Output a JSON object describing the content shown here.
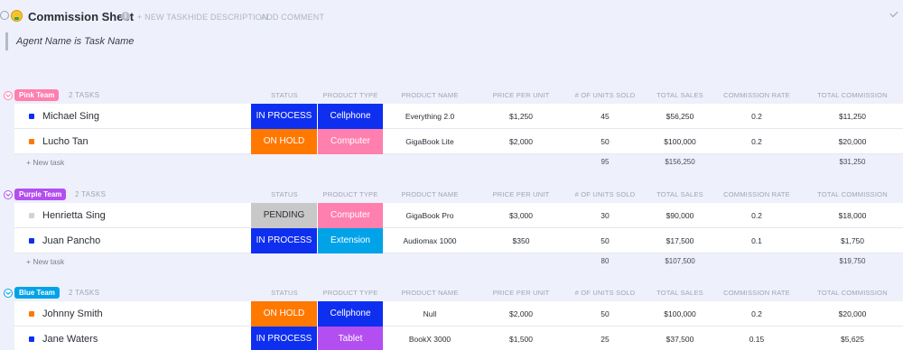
{
  "header": {
    "title": "Commission Sheet",
    "info_icon": "i",
    "actions": [
      "+ NEW TASK",
      "HIDE DESCRIPTION",
      "ADD COMMENT"
    ],
    "description": "Agent Name is Task Name"
  },
  "columns": [
    "STATUS",
    "PRODUCT TYPE",
    "PRODUCT NAME",
    "PRICE PER UNIT",
    "# OF UNITS SOLD",
    "TOTAL SALES",
    "COMMISSION RATE",
    "TOTAL COMMISSION"
  ],
  "colors": {
    "in_process": "#0f2ff0",
    "on_hold": "#ff7800",
    "pending": "#c8c8c8",
    "cellphone": "#0f2ff0",
    "computer": "#ff7fae",
    "extension": "#00a3e8",
    "tablet": "#b34ff0",
    "pink_team": "#ff7fae",
    "purple_team": "#b34ff0",
    "blue_team": "#00a3e8"
  },
  "groups": [
    {
      "name": "Pink Team",
      "color": "#ff7fae",
      "count": "2 TASKS",
      "new_task": "+ New task",
      "totals": {
        "units": "95",
        "sales": "$156,250",
        "commission": "$31,250"
      },
      "rows": [
        {
          "name": "Michael Sing",
          "dot": "#0f2ff0",
          "status": "IN PROCESS",
          "status_color": "#0f2ff0",
          "status_text": "#ffffff",
          "type": "Cellphone",
          "type_color": "#0f2ff0",
          "product": "Everything 2.0",
          "price": "$1,250",
          "units": "45",
          "sales": "$56,250",
          "rate": "0.2",
          "commission": "$11,250"
        },
        {
          "name": "Lucho Tan",
          "dot": "#ff7800",
          "status": "ON HOLD",
          "status_color": "#ff7800",
          "status_text": "#ffffff",
          "type": "Computer",
          "type_color": "#ff7fae",
          "product": "GigaBook Lite",
          "price": "$2,000",
          "units": "50",
          "sales": "$100,000",
          "rate": "0.2",
          "commission": "$20,000"
        }
      ]
    },
    {
      "name": "Purple Team",
      "color": "#b34ff0",
      "count": "2 TASKS",
      "new_task": "+ New task",
      "totals": {
        "units": "80",
        "sales": "$107,500",
        "commission": "$19,750"
      },
      "rows": [
        {
          "name": "Henrietta Sing",
          "dot": "#d3d3d3",
          "status": "PENDING",
          "status_color": "#c8c8c8",
          "status_text": "#2a2e34",
          "type": "Computer",
          "type_color": "#ff7fae",
          "product": "GigaBook Pro",
          "price": "$3,000",
          "units": "30",
          "sales": "$90,000",
          "rate": "0.2",
          "commission": "$18,000"
        },
        {
          "name": "Juan Pancho",
          "dot": "#0f2ff0",
          "status": "IN PROCESS",
          "status_color": "#0f2ff0",
          "status_text": "#ffffff",
          "type": "Extension",
          "type_color": "#00a3e8",
          "product": "Audiomax 1000",
          "price": "$350",
          "units": "50",
          "sales": "$17,500",
          "rate": "0.1",
          "commission": "$1,750"
        }
      ]
    },
    {
      "name": "Blue Team",
      "color": "#00a3e8",
      "count": "2 TASKS",
      "new_task": "",
      "totals": {
        "units": "",
        "sales": "",
        "commission": ""
      },
      "rows": [
        {
          "name": "Johnny Smith",
          "dot": "#ff7800",
          "status": "ON HOLD",
          "status_color": "#ff7800",
          "status_text": "#ffffff",
          "type": "Cellphone",
          "type_color": "#0f2ff0",
          "product": "Null",
          "price": "$2,000",
          "units": "50",
          "sales": "$100,000",
          "rate": "0.2",
          "commission": "$20,000"
        },
        {
          "name": "Jane Waters",
          "dot": "#0f2ff0",
          "status": "IN PROCESS",
          "status_color": "#0f2ff0",
          "status_text": "#ffffff",
          "type": "Tablet",
          "type_color": "#b34ff0",
          "product": "BookX 3000",
          "price": "$1,500",
          "units": "25",
          "sales": "$37,500",
          "rate": "0.15",
          "commission": "$5,625"
        }
      ]
    }
  ]
}
